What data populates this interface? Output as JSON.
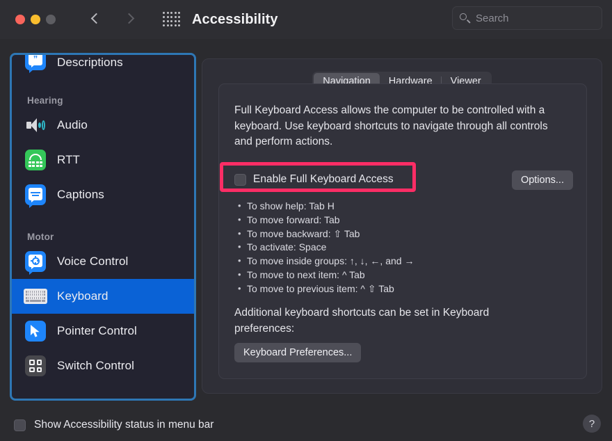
{
  "titlebar": {
    "title": "Accessibility",
    "back_icon": "chevron-left-icon",
    "forward_icon": "chevron-right-icon",
    "grid_icon": "show-all-grid-icon",
    "traffic": [
      "close-button",
      "minimize-button",
      "zoom-button"
    ]
  },
  "search": {
    "placeholder": "Search",
    "icon": "search-icon"
  },
  "sidebar": {
    "items": [
      {
        "label": "Descriptions",
        "icon": "descriptions-icon",
        "type": "item",
        "selected": false
      },
      {
        "label": "Hearing",
        "type": "header"
      },
      {
        "label": "Audio",
        "icon": "audio-icon",
        "type": "item",
        "selected": false
      },
      {
        "label": "RTT",
        "icon": "rtt-icon",
        "type": "item",
        "selected": false
      },
      {
        "label": "Captions",
        "icon": "captions-icon",
        "type": "item",
        "selected": false
      },
      {
        "label": "Motor",
        "type": "header"
      },
      {
        "label": "Voice Control",
        "icon": "voice-control-icon",
        "type": "item",
        "selected": false
      },
      {
        "label": "Keyboard",
        "icon": "keyboard-icon",
        "type": "item",
        "selected": true
      },
      {
        "label": "Pointer Control",
        "icon": "pointer-control-icon",
        "type": "item",
        "selected": false
      },
      {
        "label": "Switch Control",
        "icon": "switch-control-icon",
        "type": "item",
        "selected": false
      }
    ],
    "focus_ring_color": "#2e77b5",
    "selection_color": "#0a62d6"
  },
  "main": {
    "tabs": [
      {
        "label": "Navigation",
        "active": true
      },
      {
        "label": "Hardware",
        "active": false
      },
      {
        "label": "Viewer",
        "active": false
      }
    ],
    "description": "Full Keyboard Access allows the computer to be controlled with a keyboard. Use keyboard shortcuts to navigate through all controls and perform actions.",
    "enable_checkbox": {
      "label": "Enable Full Keyboard Access",
      "checked": false
    },
    "options_button": "Options...",
    "shortcuts": [
      "To show help: Tab H",
      "To move forward: Tab",
      "To move backward: ⇧ Tab",
      "To activate: Space",
      "To move inside groups: ↑, ↓, ←, and →",
      "To move to next item: ^ Tab",
      "To move to previous item: ^ ⇧ Tab"
    ],
    "additional_text": "Additional keyboard shortcuts can be set in Keyboard preferences:",
    "keyboard_prefs_button": "Keyboard Preferences...",
    "annotation_color": "#fb2d65"
  },
  "footer": {
    "show_status_checkbox": {
      "label": "Show Accessibility status in menu bar",
      "checked": false
    },
    "help_label": "?"
  }
}
